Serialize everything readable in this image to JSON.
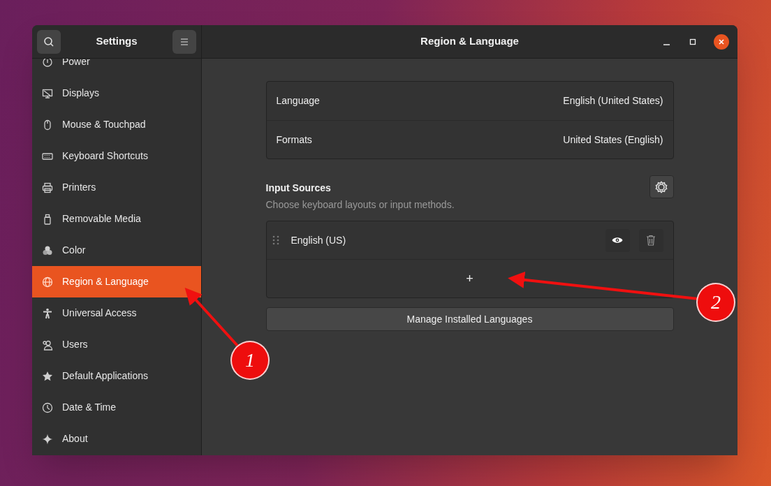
{
  "window": {
    "title": "Region & Language"
  },
  "sidebar": {
    "title": "Settings",
    "items": [
      {
        "label": "Power",
        "selected": false
      },
      {
        "label": "Displays",
        "selected": false
      },
      {
        "label": "Mouse & Touchpad",
        "selected": false
      },
      {
        "label": "Keyboard Shortcuts",
        "selected": false
      },
      {
        "label": "Printers",
        "selected": false
      },
      {
        "label": "Removable Media",
        "selected": false
      },
      {
        "label": "Color",
        "selected": false
      },
      {
        "label": "Region & Language",
        "selected": true
      },
      {
        "label": "Universal Access",
        "selected": false
      },
      {
        "label": "Users",
        "selected": false
      },
      {
        "label": "Default Applications",
        "selected": false
      },
      {
        "label": "Date & Time",
        "selected": false
      },
      {
        "label": "About",
        "selected": false
      }
    ]
  },
  "language_settings": [
    {
      "label": "Language",
      "value": "English (United States)"
    },
    {
      "label": "Formats",
      "value": "United States (English)"
    }
  ],
  "input_sources": {
    "title": "Input Sources",
    "subtitle": "Choose keyboard layouts or input methods.",
    "sources": [
      "English (US)"
    ],
    "add_label": "+"
  },
  "manage_button": "Manage Installed Languages",
  "annotations": [
    {
      "number": "1"
    },
    {
      "number": "2"
    }
  ]
}
